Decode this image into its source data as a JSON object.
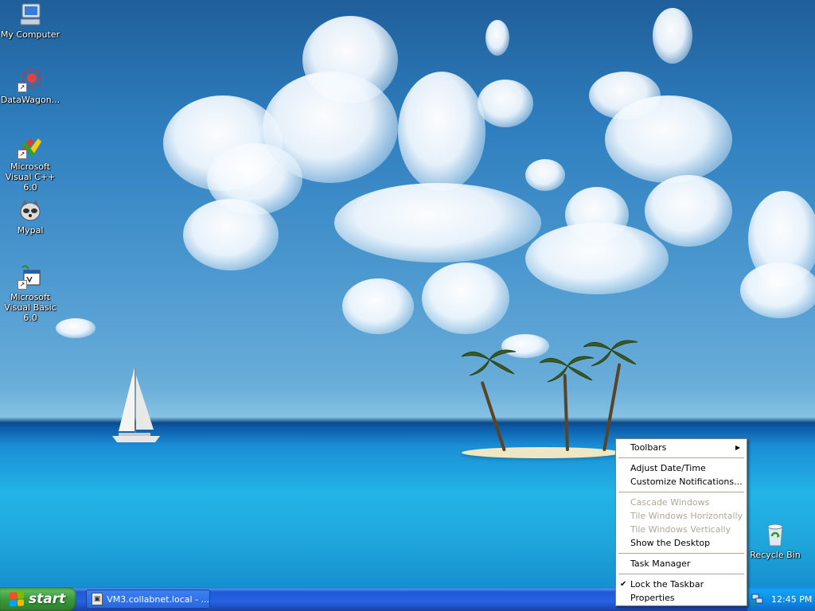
{
  "desktop": {
    "icons": [
      {
        "label": "My Computer",
        "icon": "my-computer-icon"
      },
      {
        "label": "DataWagon...",
        "icon": "datawagon-icon"
      },
      {
        "label": "Microsoft Visual C++ 6.0",
        "icon": "visual-cpp-icon"
      },
      {
        "label": "Mypal",
        "icon": "mypal-icon"
      },
      {
        "label": "Microsoft Visual Basic 6.0",
        "icon": "visual-basic-icon"
      }
    ],
    "recycle_bin": {
      "label": "Recycle Bin",
      "icon": "recycle-bin-icon"
    }
  },
  "context_menu": {
    "items": {
      "toolbars": "Toolbars",
      "adjust_datetime": "Adjust Date/Time",
      "customize_notifications": "Customize Notifications...",
      "cascade_windows": "Cascade Windows",
      "tile_horizontally": "Tile Windows Horizontally",
      "tile_vertically": "Tile Windows Vertically",
      "show_desktop": "Show the Desktop",
      "task_manager": "Task Manager",
      "lock_taskbar": "Lock the Taskbar",
      "properties": "Properties"
    },
    "check_glyph": "✔",
    "submenu_glyph": "▶"
  },
  "taskbar": {
    "start_label": "start",
    "task_button": {
      "label": "VM3.collabnet.local - ...",
      "icon": "remote-desktop-icon"
    },
    "tray": {
      "clock": "12:45 PM",
      "icon": "network-icon"
    }
  },
  "colors": {
    "taskbar_blue": "#2663e0",
    "start_green": "#3a9a3a",
    "tray_blue": "#0e8ae5",
    "menu_disabled": "#aca899"
  }
}
